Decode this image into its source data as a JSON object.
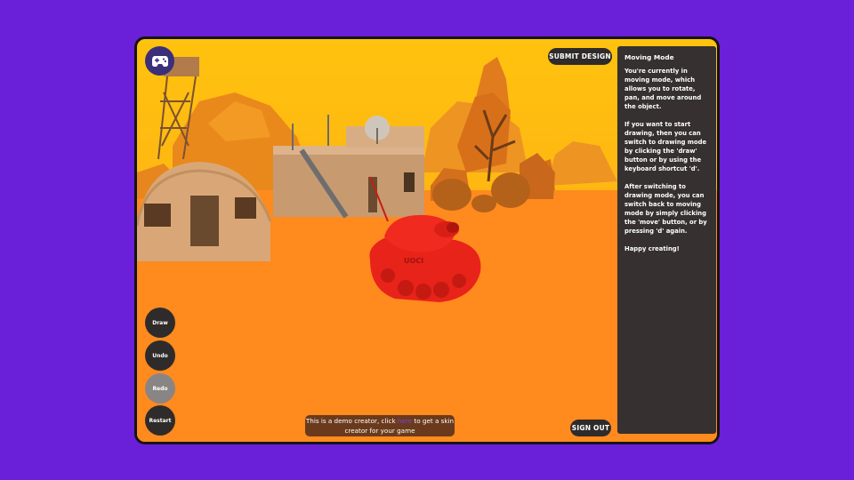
{
  "toolbar": {
    "submit_label": "SUBMIT DESIGN",
    "signout_label": "SIGN OUT"
  },
  "tools": {
    "draw": "Draw",
    "undo": "Undo",
    "redo": "Redo",
    "restart": "Restart"
  },
  "banner": {
    "prefix": "This is a demo creator, click ",
    "link": "here",
    "suffix": " to get a skin creator for your game"
  },
  "panel": {
    "title": "Moving Mode",
    "paragraphs": [
      "You're currently in moving mode, which allows you to rotate, pan, and move around the object.",
      "If you want to start drawing, then you can switch to drawing mode by clicking the 'draw' button or by using the keyboard shortcut 'd'.",
      "After switching to drawing mode, you can switch back to moving mode by simply clicking the 'move' button, or by pressing 'd' again.",
      "Happy creating!"
    ]
  },
  "model": {
    "tank_decal": "UOCI"
  },
  "colors": {
    "background": "#6a1fd9",
    "sky": "#ffb40f",
    "ground": "#ff8a1e",
    "tank": "#e8231a",
    "panel": "#363030",
    "button": "#2f2b2b",
    "button_disabled": "#8a8585",
    "link": "#7d3fe6"
  },
  "icons": {
    "gamepad": "gamepad-icon"
  }
}
